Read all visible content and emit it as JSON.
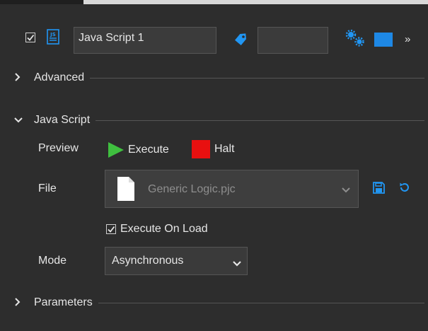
{
  "header": {
    "enabled_checked": true,
    "script_name": "Java Script 1",
    "tag_value": "",
    "more_glyph": "»",
    "accent_color": "#1e88e5"
  },
  "sections": {
    "advanced": {
      "label": "Advanced",
      "expanded": false
    },
    "java_script": {
      "label": "Java Script",
      "expanded": true
    },
    "parameters": {
      "label": "Parameters",
      "expanded": false
    }
  },
  "preview": {
    "label": "Preview",
    "execute_label": "Execute",
    "halt_label": "Halt",
    "execute_color": "#3fbf3f",
    "halt_color": "#e81010"
  },
  "file": {
    "label": "File",
    "value": "Generic Logic.pjc"
  },
  "execute_on_load": {
    "label": "Execute On Load",
    "checked": true
  },
  "mode": {
    "label": "Mode",
    "selected": "Asynchronous"
  },
  "icons": {
    "chevron_right": "›",
    "chevron_down": "⌄"
  }
}
